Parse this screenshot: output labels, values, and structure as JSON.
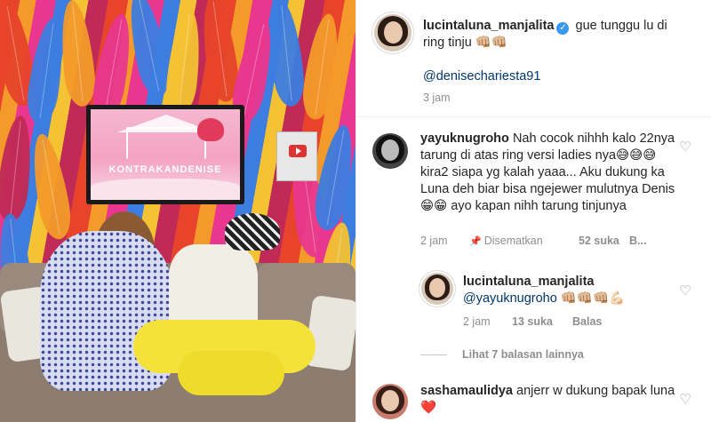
{
  "photo": {
    "tv_brand": "KONTRAKANDENISE"
  },
  "caption": {
    "username": "lucintaluna_manjalita",
    "text": "gue tunggu lu di ring tinju 👊🏼👊🏼",
    "mention": "@denisechariesta91",
    "time": "3 jam"
  },
  "comments": [
    {
      "username": "yayuknugroho",
      "text": "Nah cocok nihhh kalo 22nya tarung di atas ring versi ladies nya😅😅😅 kira2 siapa yg kalah yaaa... Aku dukung ka Luna deh biar bisa ngejewer mulutnya Denis 😁😁 ayo kapan nihh tarung tinjunya",
      "time": "2 jam",
      "pinned": "Disematkan",
      "likes": "52 suka",
      "reply_label": "B..."
    },
    {
      "username": "lucintaluna_manjalita",
      "mention": "@yayuknugroho",
      "text": " 👊🏼👊🏼👊🏼💪🏻",
      "time": "2 jam",
      "likes": "13 suka",
      "reply_label": "Balas"
    },
    {
      "view_replies": "Lihat 7 balasan lainnya"
    },
    {
      "username": "sashamaulidya",
      "text": "anjerr w dukung bapak luna❤️"
    }
  ],
  "icons": {
    "heart": "heart-outline-icon",
    "verified": "verified-badge-icon",
    "pin": "pin-icon"
  },
  "colors": {
    "verified": "#3897f0",
    "mention": "#00376b",
    "meta": "#8e8e8e"
  }
}
